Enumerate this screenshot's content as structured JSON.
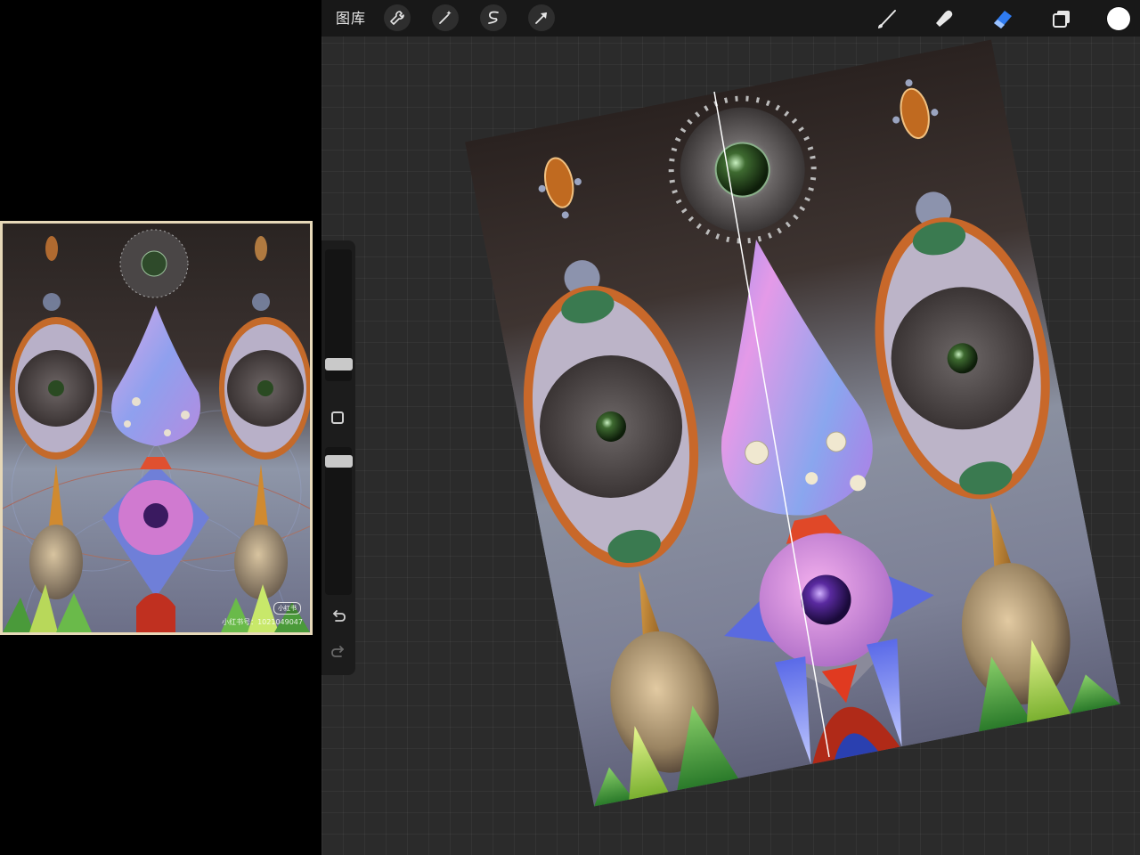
{
  "reference": {
    "badge": "小红书",
    "caption": "小红书号：1021049047"
  },
  "toolbar": {
    "gallery_label": "图库",
    "left_tools": [
      "wrench-icon",
      "magic-wand-icon",
      "selection-icon",
      "transform-arrow-icon"
    ],
    "right_tools": [
      "brush-icon",
      "smudge-icon",
      "eraser-icon",
      "layers-icon"
    ],
    "active_tool": "eraser-icon",
    "active_color": "#ffffff",
    "accent": "#2f7bf0"
  },
  "sidebar": {
    "controls": [
      "brush-size-slider",
      "modify-button",
      "opacity-slider",
      "undo-icon",
      "redo-icon"
    ]
  }
}
